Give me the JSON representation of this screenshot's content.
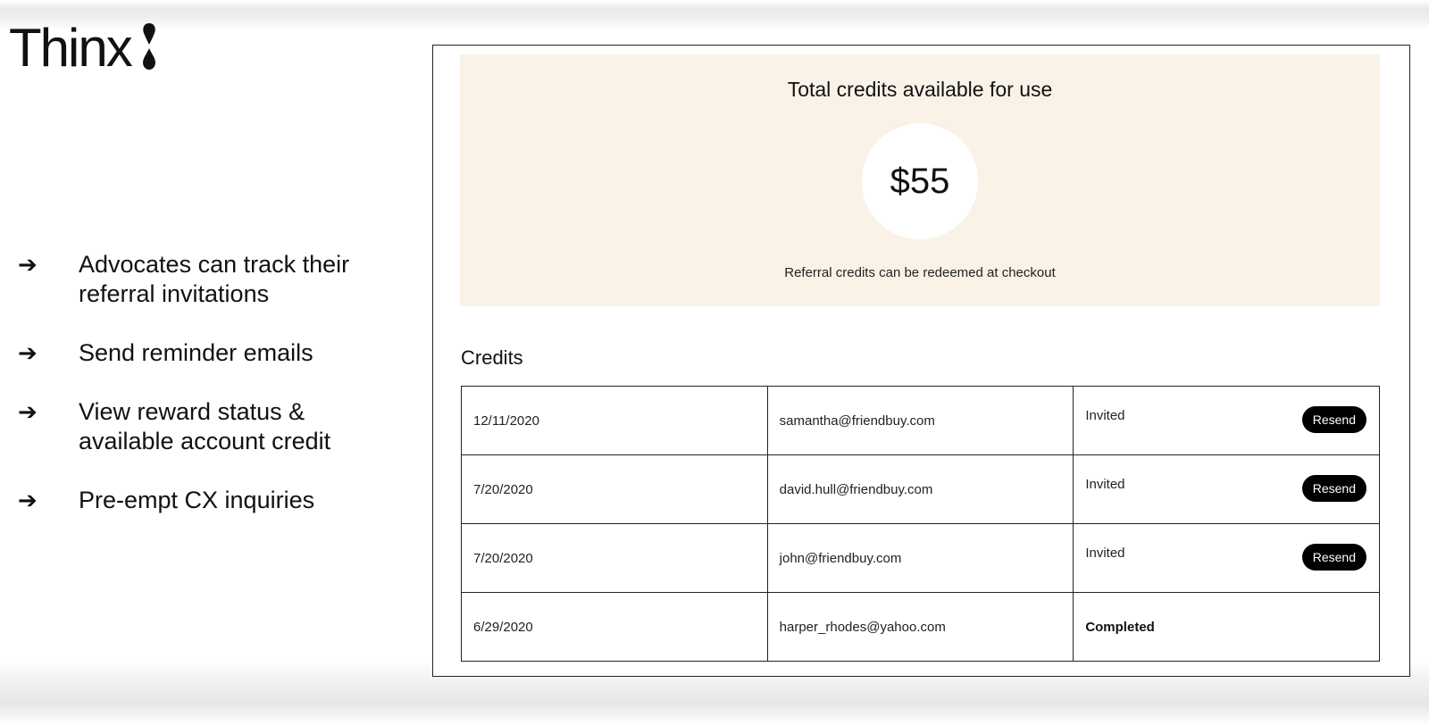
{
  "brand": {
    "name": "Thinx"
  },
  "bullets": [
    {
      "text": "Advocates can track their referral invitations"
    },
    {
      "text": "Send reminder emails"
    },
    {
      "text": "View reward status & available account credit"
    },
    {
      "text": "Pre-empt CX inquiries"
    }
  ],
  "bullet_arrow": "➔",
  "credits": {
    "title": "Total credits available for use",
    "amount": "$55",
    "note": "Referral credits can be redeemed at checkout"
  },
  "table": {
    "title": "Credits",
    "rows": [
      {
        "date": "12/11/2020",
        "email": "samantha@friendbuy.com",
        "status": "Invited",
        "action": "Resend"
      },
      {
        "date": "7/20/2020",
        "email": "david.hull@friendbuy.com",
        "status": "Invited",
        "action": "Resend"
      },
      {
        "date": "7/20/2020",
        "email": "john@friendbuy.com",
        "status": "Invited",
        "action": "Resend"
      },
      {
        "date": "6/29/2020",
        "email": "harper_rhodes@yahoo.com",
        "status": "Completed"
      }
    ]
  },
  "colors": {
    "credits_bg": "#faf2e7",
    "button_bg": "#000000",
    "button_text": "#ffffff"
  },
  "icons": {
    "logo_mark": "water-drop-icon"
  }
}
